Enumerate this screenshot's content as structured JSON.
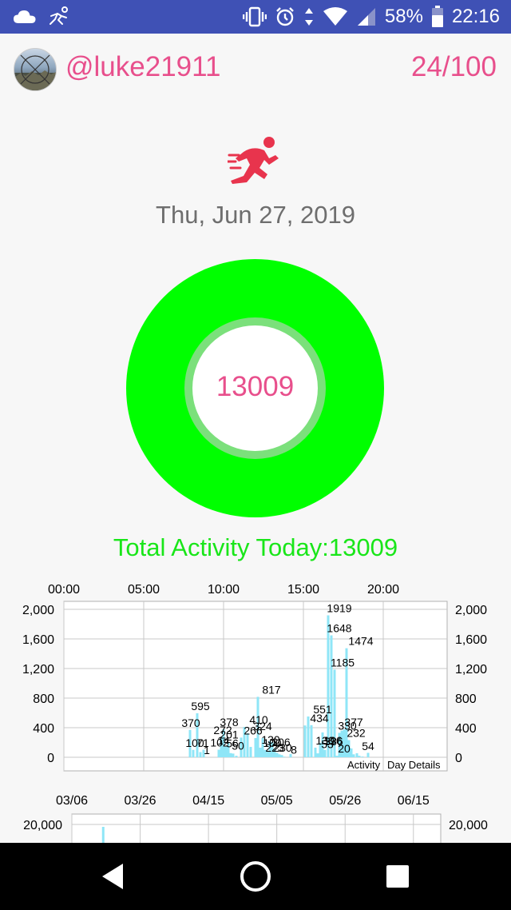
{
  "status_bar": {
    "icons": [
      "cloud-icon",
      "runner-notification-icon",
      "vibrate-icon",
      "alarm-icon",
      "data-arrows-icon",
      "wifi-icon",
      "signal-icon",
      "battery-icon"
    ],
    "battery": "58%",
    "time": "22:16"
  },
  "header": {
    "username": "@luke21911",
    "progress": "24/100"
  },
  "date": "Thu, Jun 27, 2019",
  "donut": {
    "value": "13009",
    "ring_color": "#00ff00",
    "ring_fill_fraction": 1.0
  },
  "total_label": "Total Activity Today:13009",
  "colors": {
    "accent_pink": "#e84f8c",
    "green": "#00ff00",
    "status_bar": "#3f51b5",
    "bar": "#8fe6f7"
  },
  "chart_data": [
    {
      "type": "bar",
      "x_axis_top_ticks": [
        "00:00",
        "05:00",
        "10:00",
        "15:00",
        "20:00"
      ],
      "y_ticks": [
        "0",
        "400",
        "800",
        "1,200",
        "1,600",
        "2,000"
      ],
      "ylim": [
        0,
        2000
      ],
      "xlim_hours": [
        0,
        24
      ],
      "legend": [
        "Activity",
        "Day Details"
      ],
      "grid": true,
      "series": [
        {
          "hours": [
            7.9,
            8.1,
            8.35,
            8.55,
            8.75,
            8.95,
            9.7,
            9.85,
            10.0,
            10.15,
            10.3,
            10.45,
            10.6,
            10.8,
            11.1,
            11.3,
            11.5,
            11.7,
            12.0,
            12.15,
            12.3,
            12.45,
            12.6,
            12.75,
            12.9,
            13.05,
            13.2,
            13.35,
            13.5,
            13.65,
            13.8,
            14.2,
            15.1,
            15.3,
            15.5,
            15.75,
            15.9,
            16.05,
            16.2,
            16.35,
            16.55,
            16.75,
            16.95,
            17.1,
            17.25,
            17.4,
            17.55,
            17.7,
            17.85,
            18.0,
            18.15,
            18.35,
            18.5,
            18.7,
            19.05
          ],
          "values": [
            370,
            100,
            595,
            70,
            102,
            1,
            102,
            272,
            378,
            145,
            201,
            56,
            50,
            20,
            266,
            410,
            324,
            140,
            260,
            817,
            130,
            260,
            100,
            80,
            223,
            206,
            110,
            60,
            40,
            30,
            8,
            45,
            430,
            551,
            434,
            130,
            53,
            196,
            336,
            100,
            1919,
            1648,
            1185,
            20,
            330,
            360,
            377,
            1474,
            232,
            120,
            40,
            54,
            20,
            10,
            60
          ],
          "labels": [
            {
              "h": 7.95,
              "v": 370,
              "text": "370"
            },
            {
              "h": 8.2,
              "v": 100,
              "text": "100"
            },
            {
              "h": 8.55,
              "v": 595,
              "text": "595"
            },
            {
              "h": 8.7,
              "v": 100,
              "text": "71"
            },
            {
              "h": 8.95,
              "v": 1,
              "text": "1"
            },
            {
              "h": 9.75,
              "v": 102,
              "text": "102"
            },
            {
              "h": 9.95,
              "v": 272,
              "text": "272"
            },
            {
              "h": 10.35,
              "v": 378,
              "text": "378"
            },
            {
              "h": 10.0,
              "v": 130,
              "text": "14"
            },
            {
              "h": 10.35,
              "v": 210,
              "text": "201"
            },
            {
              "h": 10.55,
              "v": 90,
              "text": "56"
            },
            {
              "h": 10.9,
              "v": 60,
              "text": "50"
            },
            {
              "h": 11.85,
              "v": 266,
              "text": "266"
            },
            {
              "h": 12.2,
              "v": 410,
              "text": "410"
            },
            {
              "h": 12.45,
              "v": 324,
              "text": "324"
            },
            {
              "h": 13.0,
              "v": 817,
              "text": "817"
            },
            {
              "h": 12.95,
              "v": 140,
              "text": "130"
            },
            {
              "h": 13.05,
              "v": 100,
              "text": "100"
            },
            {
              "h": 13.6,
              "v": 110,
              "text": "206"
            },
            {
              "h": 13.2,
              "v": 30,
              "text": "223"
            },
            {
              "h": 13.7,
              "v": 30,
              "text": "230"
            },
            {
              "h": 14.4,
              "v": 8,
              "text": "8"
            },
            {
              "h": 16.2,
              "v": 551,
              "text": "551"
            },
            {
              "h": 16.0,
              "v": 434,
              "text": "434"
            },
            {
              "h": 16.35,
              "v": 130,
              "text": "130"
            },
            {
              "h": 16.85,
              "v": 130,
              "text": "196"
            },
            {
              "h": 16.5,
              "v": 80,
              "text": "53"
            },
            {
              "h": 16.9,
              "v": 120,
              "text": "336"
            },
            {
              "h": 17.25,
              "v": 1919,
              "text": "1919"
            },
            {
              "h": 17.25,
              "v": 1648,
              "text": "1648"
            },
            {
              "h": 17.45,
              "v": 1185,
              "text": "1185"
            },
            {
              "h": 17.55,
              "v": 20,
              "text": "20"
            },
            {
              "h": 17.75,
              "v": 330,
              "text": "330"
            },
            {
              "h": 18.15,
              "v": 377,
              "text": "377"
            },
            {
              "h": 18.6,
              "v": 1474,
              "text": "1474"
            },
            {
              "h": 18.3,
              "v": 232,
              "text": "232"
            },
            {
              "h": 19.05,
              "v": 54,
              "text": "54"
            }
          ]
        }
      ]
    },
    {
      "type": "bar",
      "categories_ticks": [
        "03/06",
        "03/26",
        "04/15",
        "05/05",
        "05/26",
        "06/15"
      ],
      "y_ticks": [
        "20,000"
      ],
      "ylim": [
        0,
        24000
      ],
      "grid": true,
      "series": [
        {
          "x_fraction": 0.085,
          "values": [
            20000
          ]
        }
      ]
    }
  ]
}
